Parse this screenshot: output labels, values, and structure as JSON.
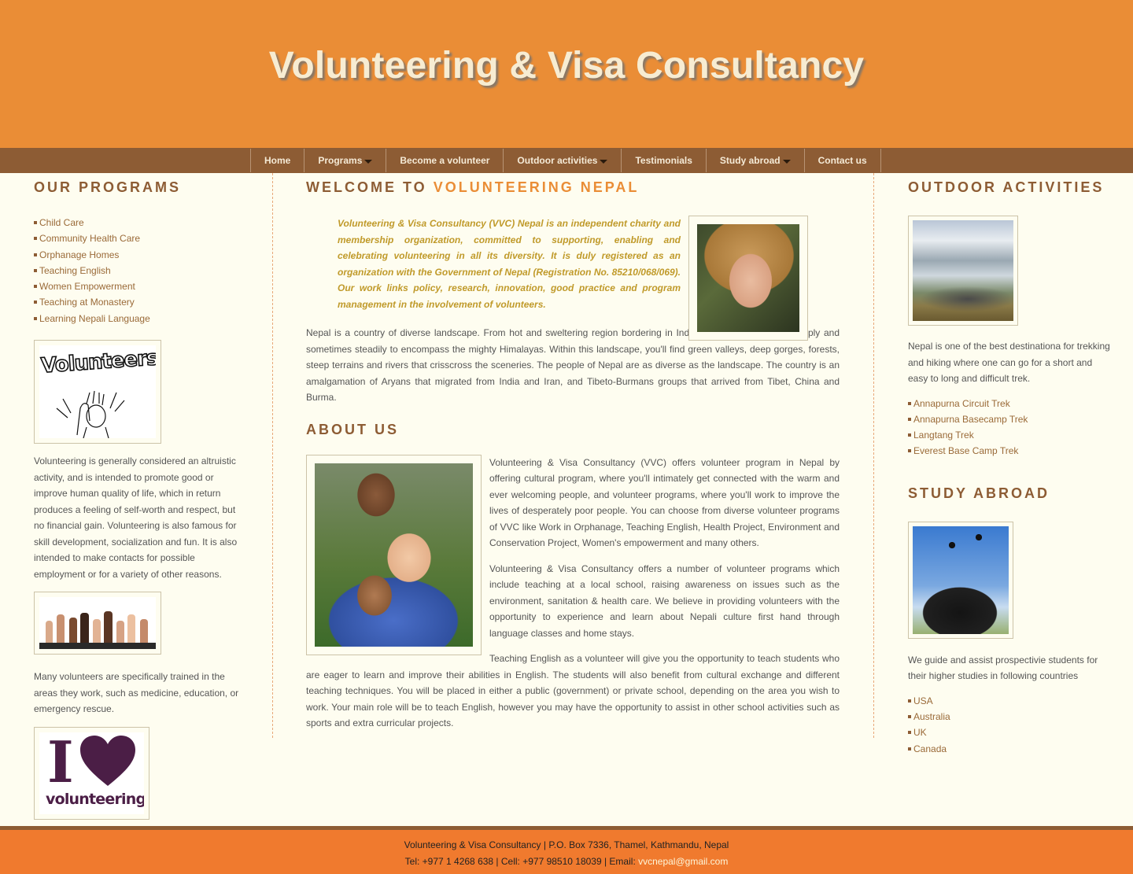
{
  "site": {
    "title": "Volunteering & Visa Consultancy"
  },
  "nav": {
    "items": [
      {
        "label": "Home",
        "dropdown": false
      },
      {
        "label": "Programs",
        "dropdown": true
      },
      {
        "label": "Become a volunteer",
        "dropdown": false
      },
      {
        "label": "Outdoor activities",
        "dropdown": true
      },
      {
        "label": "Testimonials",
        "dropdown": false
      },
      {
        "label": "Study abroad",
        "dropdown": true
      },
      {
        "label": "Contact us",
        "dropdown": false
      }
    ]
  },
  "left": {
    "heading": "Our Programs",
    "programs": [
      "Child Care",
      "Community Health Care",
      "Orphanage Homes",
      "Teaching English",
      "Women Empowerment",
      "Teaching at Monastery",
      "Learning Nepali Language"
    ],
    "badge_text": "Volunteers!",
    "para1": "Volunteering is generally considered an altruistic activity, and is intended to promote good or improve human quality of life, which in return produces a feeling of self-worth and respect, but no financial gain. Volunteering is also famous for skill development, socialization and fun. It is also intended to make contacts for possible employment or for a variety of other reasons.",
    "para2": "Many volunteers are specifically trained in the areas they work, such as medicine, education, or emergency rescue.",
    "logo_letter": "I",
    "logo_word": "volunteering"
  },
  "main": {
    "welcome_heading_1": "Welcome to",
    "welcome_heading_2": "Volunteering Nepal",
    "lead": "Volunteering & Visa Consultancy (VVC) Nepal is an independent charity and membership organization, committed to supporting, enabling and celebrating volunteering in all its diversity. It is duly registered as an organization with the Government of Nepal (Registration No. 85210/068/069). Our work links policy, research, innovation, good practice and program management in the involvement of volunteers.",
    "nepal_para": "Nepal is a country of diverse landscape. From hot and sweltering region bordering in India, the landscape rises steeply and sometimes steadily to encompass the mighty Himalayas. Within this landscape, you'll find green valleys, deep gorges, forests, steep terrains and rivers that crisscross the sceneries. The people of Nepal are as diverse as the landscape. The country is an amalgamation of Aryans that migrated from India and Iran, and Tibeto-Burmans groups that arrived from Tibet, China and Burma.",
    "about_heading": "About Us",
    "about_p1": "Volunteering & Visa Consultancy (VVC) offers volunteer program in Nepal by offering cultural program, where you'll intimately get connected with the warm and ever welcoming people, and volunteer programs, where you'll work to improve the lives of desperately poor people. You can choose from diverse volunteer programs of VVC like Work in Orphanage, Teaching English, Health Project, Environment and Conservation Project, Women's empowerment and many others.",
    "about_p2": "Volunteering & Visa Consultancy offers a number of volunteer programs which include teaching at a local school, raising awareness on issues such as the environment, sanitation & health care. We believe in providing volunteers with the opportunity to experience and learn about Nepali culture first hand through language classes and home stays.",
    "about_p3": "Teaching English as a volunteer will give you the opportunity to teach students who are eager to learn and improve their abilities in English. The students will also benefit from cultural exchange and different teaching techniques. You will be placed in either a public (government) or private school, depending on the area you wish to work. Your main role will be to teach English, however you may have the opportunity to assist in other school activities such as sports and extra curricular projects."
  },
  "right": {
    "outdoor_heading": "Outdoor Activities",
    "outdoor_para": "Nepal is one of the best destinationa for trekking and hiking where one can go for a short and easy to long and difficult trek.",
    "treks": [
      "Annapurna Circuit Trek",
      "Annapurna Basecamp Trek",
      "Langtang Trek",
      "Everest Base Camp Trek"
    ],
    "study_heading": "Study Abroad",
    "study_para": "We guide and assist prospectivie students for their higher studies in following countries",
    "countries": [
      "USA",
      "Australia",
      "UK",
      "Canada"
    ]
  },
  "footer": {
    "line1": "Volunteering & Visa Consultancy | P.O. Box 7336, Thamel, Kathmandu, Nepal",
    "line2_prefix": "Tel: +977 1 4268 638 | Cell: +977 98510 18039 | Email: ",
    "email": "vvcnepal@gmail.com"
  },
  "colors": {
    "header": "#ea8d36",
    "nav": "#8d5c34",
    "footer": "#f07a2e",
    "accent": "#ea8d36",
    "page_bg": "#fefdf0"
  }
}
